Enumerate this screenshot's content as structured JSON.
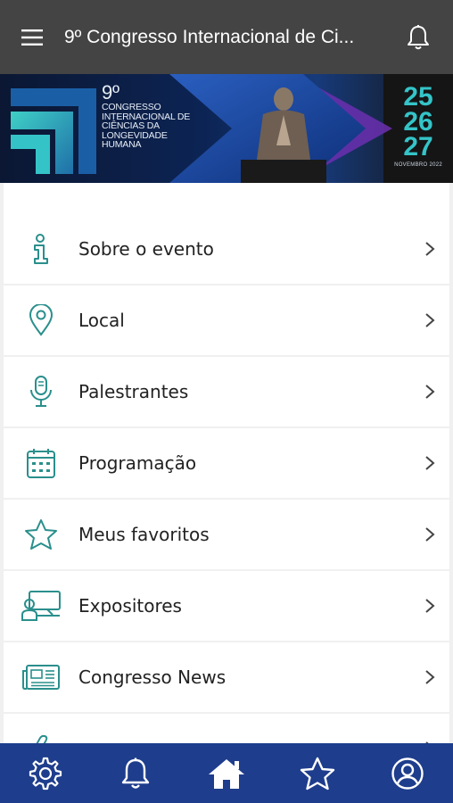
{
  "header": {
    "title": "9º Congresso Internacional de Ci...",
    "menu_icon": "hamburger-icon",
    "notification_icon": "bell-icon"
  },
  "banner": {
    "ordinal": "9º",
    "title": "Congresso Internacional de Ciências da Longevidade Humana",
    "dates": [
      "25",
      "26",
      "27"
    ],
    "month": "NOVEMBRO 2022"
  },
  "menu": {
    "items": [
      {
        "label": "Sobre o evento",
        "icon": "info-icon"
      },
      {
        "label": "Local",
        "icon": "map-pin-icon"
      },
      {
        "label": "Palestrantes",
        "icon": "microphone-icon"
      },
      {
        "label": "Programação",
        "icon": "calendar-icon"
      },
      {
        "label": "Meus favoritos",
        "icon": "star-icon"
      },
      {
        "label": "Expositores",
        "icon": "exhibitor-icon"
      },
      {
        "label": "Congresso News",
        "icon": "newspaper-icon"
      }
    ]
  },
  "bottom_nav": {
    "tabs": [
      {
        "name": "settings",
        "icon": "gear-icon"
      },
      {
        "name": "notifications",
        "icon": "bell-icon"
      },
      {
        "name": "home",
        "icon": "home-icon"
      },
      {
        "name": "favorites",
        "icon": "star-icon"
      },
      {
        "name": "profile",
        "icon": "user-icon"
      }
    ]
  },
  "colors": {
    "topbar": "#444444",
    "accent": "#2a8f8c",
    "bottombar": "#1e3d8c",
    "dates": "#34c4c8"
  }
}
